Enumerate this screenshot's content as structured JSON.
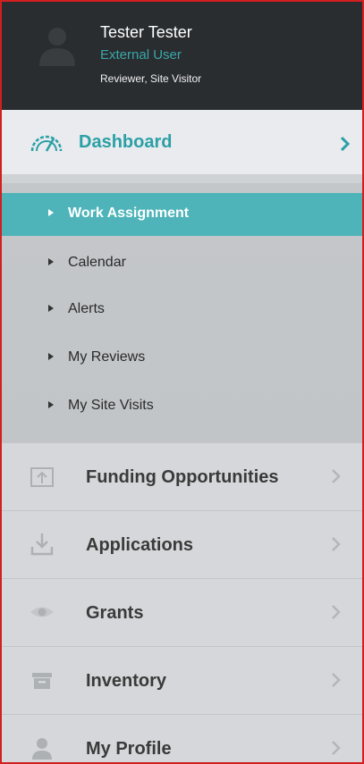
{
  "user": {
    "name": "Tester Tester",
    "role": "External User",
    "permissions": "Reviewer, Site Visitor",
    "avatar_icon": "user-silhouette-icon"
  },
  "dashboard": {
    "label": "Dashboard",
    "icon": "speedometer-icon",
    "accent": "#2aa0a6"
  },
  "submenu": [
    {
      "label": "Work Assignment",
      "active": true
    },
    {
      "label": "Calendar",
      "active": false
    },
    {
      "label": "Alerts",
      "active": false
    },
    {
      "label": "My Reviews",
      "active": false
    },
    {
      "label": "My Site Visits",
      "active": false
    }
  ],
  "nav": [
    {
      "label": "Funding Opportunities",
      "icon": "upload-box-icon"
    },
    {
      "label": "Applications",
      "icon": "download-icon"
    },
    {
      "label": "Grants",
      "icon": "eye-icon"
    },
    {
      "label": "Inventory",
      "icon": "archive-box-icon"
    },
    {
      "label": "My Profile",
      "icon": "user-icon"
    }
  ],
  "colors": {
    "header_bg": "#2a2d30",
    "active_bg": "#4eb4b9",
    "border": "#d21f1f"
  }
}
